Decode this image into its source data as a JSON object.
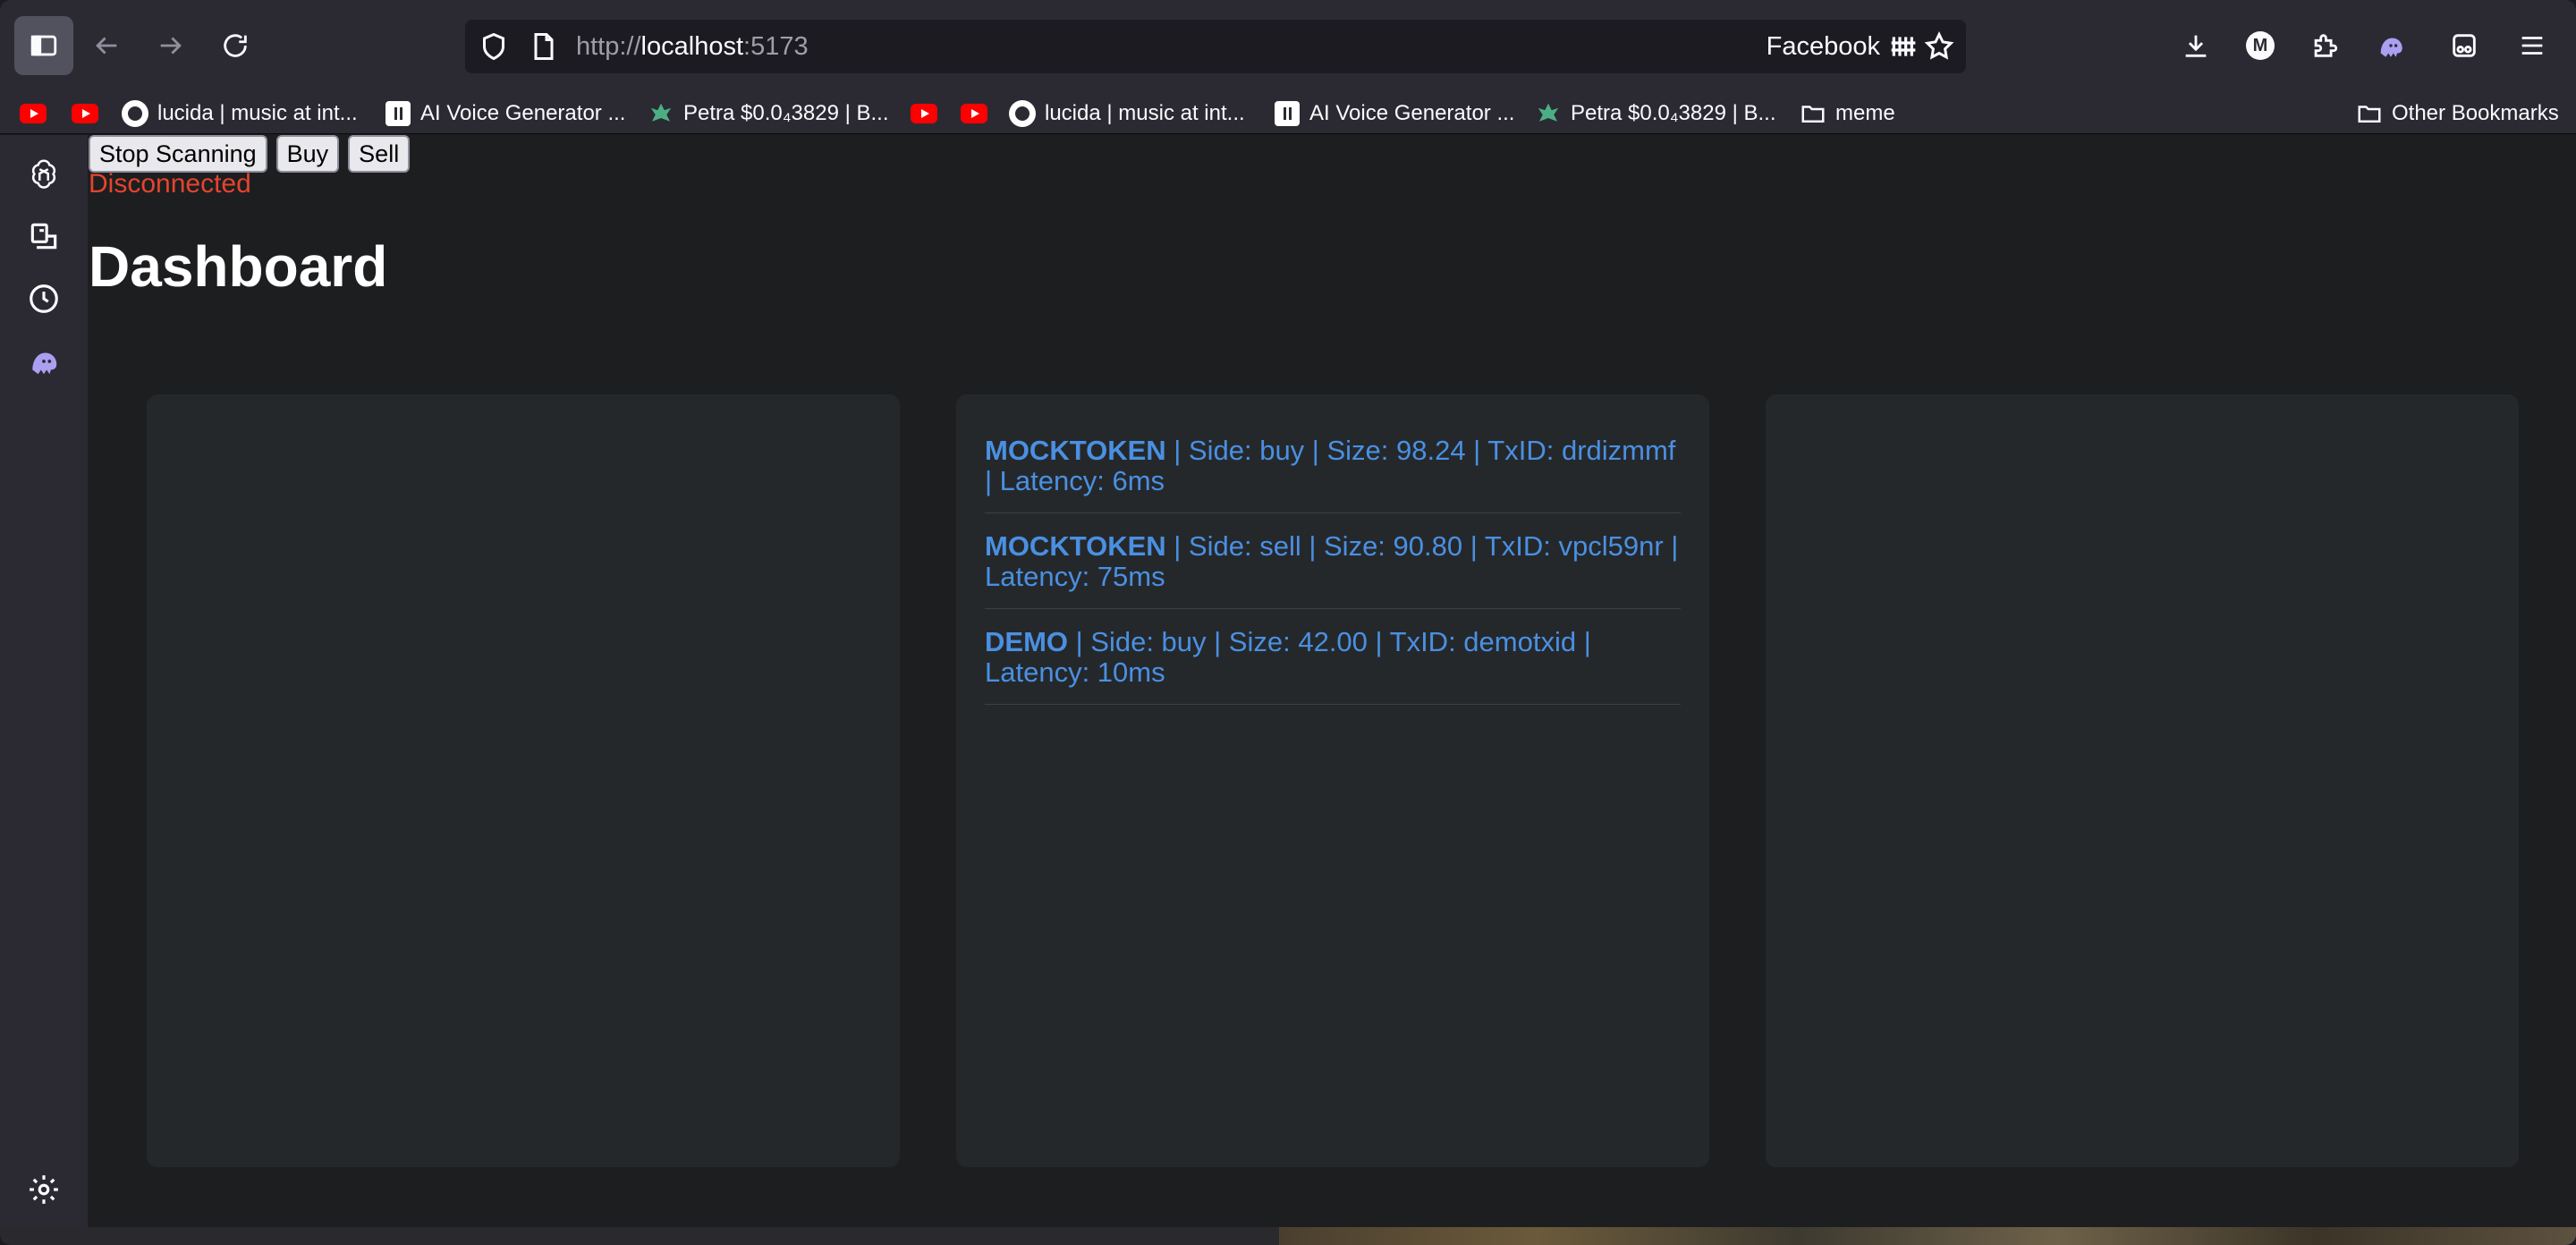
{
  "browser": {
    "url_prefix": "http://",
    "url_host": "localhost",
    "url_port": ":5173",
    "url_right_label": "Facebook",
    "bookmarks": [
      {
        "label": "",
        "icon": "youtube-icon"
      },
      {
        "label": "",
        "icon": "youtube-icon"
      },
      {
        "label": "lucida | music at int...",
        "icon": "lucida-icon"
      },
      {
        "label": "AI Voice Generator ...",
        "icon": "pause-icon"
      },
      {
        "label": "Petra $0.0₄3829 | B...",
        "icon": "petra-icon"
      },
      {
        "label": "",
        "icon": "youtube-icon"
      },
      {
        "label": "",
        "icon": "youtube-icon"
      },
      {
        "label": "lucida | music at int...",
        "icon": "lucida-icon"
      },
      {
        "label": "AI Voice Generator ...",
        "icon": "pause-icon"
      },
      {
        "label": "Petra $0.0₄3829 | B...",
        "icon": "petra-icon"
      },
      {
        "label": "meme",
        "icon": "folder-icon"
      }
    ],
    "other_bookmarks": "Other Bookmarks",
    "avatar_letter": "M"
  },
  "app": {
    "buttons": {
      "stop": "Stop Scanning",
      "buy": "Buy",
      "sell": "Sell"
    },
    "status": "Disconnected",
    "title": "Dashboard",
    "trades": [
      {
        "token": "MOCKTOKEN",
        "detail": " | Side: buy | Size: 98.24 | TxID: drdizmmf | Latency: 6ms"
      },
      {
        "token": "MOCKTOKEN",
        "detail": " | Side: sell | Size: 90.80 | TxID: vpcl59nr | Latency: 75ms"
      },
      {
        "token": "DEMO",
        "detail": " | Side: buy | Size: 42.00 | TxID: demotxid | Latency: 10ms"
      }
    ]
  },
  "colors": {
    "status": "#e5442d",
    "trade_text": "#4a90e2",
    "panel": "#25282b",
    "page_bg": "#1d1e20"
  }
}
